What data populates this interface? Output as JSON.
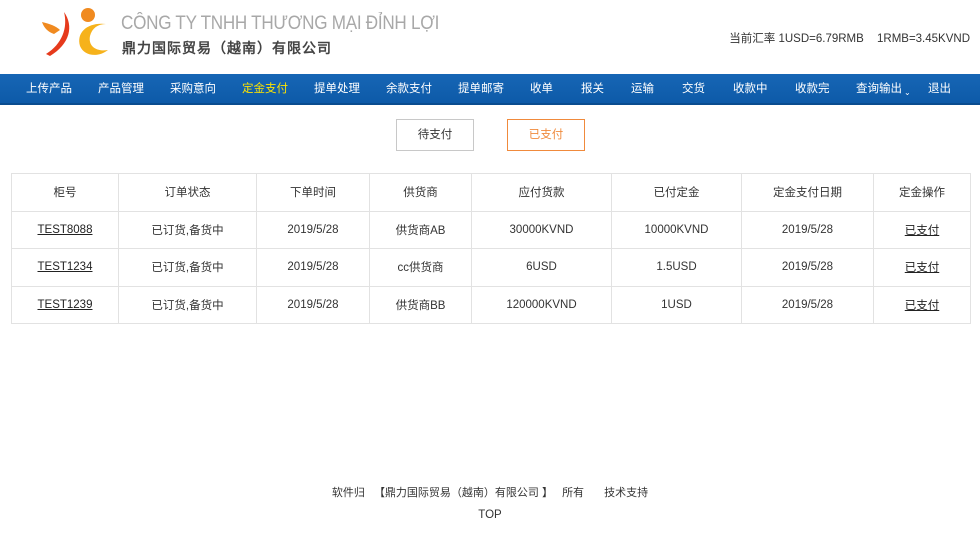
{
  "header": {
    "company_vn": "CÔNG TY TNHH THƯƠNG MẠI ĐỈNH LỢI",
    "company_cn": "鼎力国际贸易（越南）有限公司",
    "rate_usd": "当前汇率 1USD=6.79RMB",
    "rate_rmb": "1RMB=3.45KVND",
    "logo_colors": {
      "orange": "#f08a20",
      "red": "#e63a1c",
      "yellow": "#f6b21b"
    }
  },
  "nav": {
    "items": [
      {
        "label": "上传产品"
      },
      {
        "label": "产品管理"
      },
      {
        "label": "采购意向"
      },
      {
        "label": "定金支付"
      },
      {
        "label": "提单处理"
      },
      {
        "label": "余款支付"
      },
      {
        "label": "提单邮寄"
      },
      {
        "label": "收单"
      },
      {
        "label": "报关"
      },
      {
        "label": "运输"
      },
      {
        "label": "交货"
      },
      {
        "label": "收款中"
      },
      {
        "label": "收款完"
      },
      {
        "label": "查询输出"
      },
      {
        "label": "退出"
      }
    ],
    "active": "定金支付",
    "bg_color": "#1766b5",
    "active_color": "#ffe400"
  },
  "tabs": {
    "pending": "待支付",
    "paid": "已支付",
    "active_color": "#f08a3c"
  },
  "table": {
    "headers": [
      "柜号",
      "订单状态",
      "下单时间",
      "供货商",
      "应付货款",
      "已付定金",
      "定金支付日期",
      "定金操作"
    ],
    "rows": [
      [
        "TEST8088",
        "已订货,备货中",
        "2019/5/28",
        "供货商AB",
        "30000KVND",
        "10000KVND",
        "2019/5/28",
        "已支付"
      ],
      [
        "TEST1234",
        "已订货,备货中",
        "2019/5/28",
        "cc供货商",
        "6USD",
        "1.5USD",
        "2019/5/28",
        "已支付"
      ],
      [
        "TEST1239",
        "已订货,备货中",
        "2019/5/28",
        "供货商BB",
        "120000KVND",
        "1USD",
        "2019/5/28",
        "已支付"
      ]
    ]
  },
  "footer": {
    "owner_prefix": "软件归",
    "owner_name": "【鼎力国际贸易（越南）有限公司 】",
    "owner_suffix": "所有",
    "support": "技术支持",
    "top": "TOP"
  }
}
